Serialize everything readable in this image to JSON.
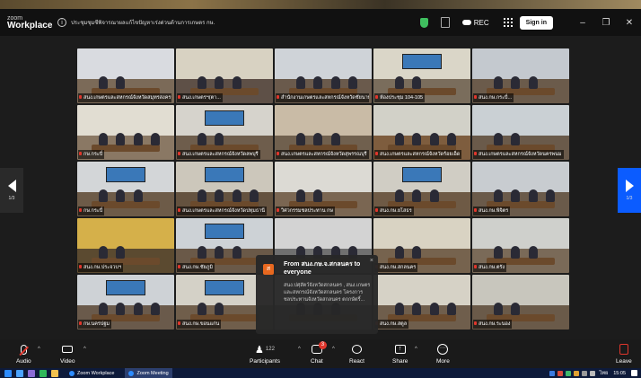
{
  "window": {
    "brand_top": "zoom",
    "brand_bottom": "Workplace",
    "meeting_title": "ประชุมชุมชีพิจารณาผลแก้ไขปัญหาเร่งด่วนด้านการเกษตร กษ.",
    "rec_label": "REC",
    "signin_label": "Sign in",
    "min_glyph": "–",
    "max_glyph": "❐",
    "close_glyph": "✕"
  },
  "tiles": [
    {
      "name": "สนง.เกษตรและสหกรณ์จังหวัดสมุทรสงคราม",
      "wall": "#d9dbe0",
      "floor": "#7b6a58",
      "screen": false,
      "active": false
    },
    {
      "name": "สนง.เกษตรฯ(ตา...",
      "wall": "#d8d2c2",
      "floor": "#5e5047",
      "screen": false,
      "active": false
    },
    {
      "name": "สำนักงานเกษตรและสหกรณ์จังหวัดชัยนาท",
      "wall": "#cfd3d8",
      "floor": "#6a5a4c",
      "screen": false,
      "active": false
    },
    {
      "name": "ห้องประชุม 104-105",
      "wall": "#dad6c8",
      "floor": "#7a6d5c",
      "screen": true,
      "active": true
    },
    {
      "name": "สนง.กษ.กระบี่...",
      "wall": "#c4c9cf",
      "floor": "#6b5b4b",
      "screen": false,
      "active": false
    },
    {
      "name": "กษ.กระบี่",
      "wall": "#e1ddd2",
      "floor": "#8a7864",
      "screen": false,
      "active": false
    },
    {
      "name": "สนง.เกษตรและสหกรณ์จังหวัดลพบุรี",
      "wall": "#d6d3cc",
      "floor": "#6e5d4c",
      "screen": true,
      "active": false
    },
    {
      "name": "สนง.เกษตรและสหกรณ์จังหวัดสุพรรณบุรี",
      "wall": "#c9bba6",
      "floor": "#70604e",
      "screen": false,
      "active": false
    },
    {
      "name": "สนง.เกษตรและสหกรณ์จังหวัดร้อยเอ็ด",
      "wall": "#d2d1c8",
      "floor": "#7e5d3e",
      "screen": false,
      "active": false
    },
    {
      "name": "สนง.เกษตรและสหกรณ์จังหวัดนครพนม",
      "wall": "#cad0d4",
      "floor": "#6a5a4a",
      "screen": false,
      "active": false
    },
    {
      "name": "กษ.กระบี่",
      "wall": "#d3d6d8",
      "floor": "#6d5b48",
      "screen": true,
      "active": false
    },
    {
      "name": "สนง.เกษตรและสหกรณ์จังหวัดปทุมธานี",
      "wall": "#ccc7bb",
      "floor": "#64523f",
      "screen": true,
      "active": false
    },
    {
      "name": "วิศวกรรมชลประทาน กษ",
      "wall": "#dcdad4",
      "floor": "#7a6652",
      "screen": false,
      "active": false
    },
    {
      "name": "สนง.กษ.ยโสธร",
      "wall": "#d0cdc4",
      "floor": "#6e5a45",
      "screen": true,
      "active": false
    },
    {
      "name": "สนง.กษ.พิจิตร",
      "wall": "#c8ccd0",
      "floor": "#6a5a4a",
      "screen": false,
      "active": false
    },
    {
      "name": "สนง.กษ.ประจวบฯ",
      "wall": "#d5b04a",
      "floor": "#5b4a30",
      "screen": false,
      "active": false
    },
    {
      "name": "สนง.กษ.ชัยภูมิ",
      "wall": "#cdd2d6",
      "floor": "#6a5948",
      "screen": true,
      "active": false
    },
    {
      "name": "",
      "wall": "#d3d3d3",
      "floor": "#707070",
      "screen": false,
      "active": false
    },
    {
      "name": "สนง.กษ.สกลนคร",
      "wall": "#d9d3c3",
      "floor": "#76634e",
      "screen": false,
      "active": false
    },
    {
      "name": "สนง.กษ.ตรัง",
      "wall": "#cfd0cc",
      "floor": "#7a6a58",
      "screen": false,
      "active": false
    },
    {
      "name": "กษ.นครปฐม",
      "wall": "#ced2d6",
      "floor": "#6a5a4b",
      "screen": true,
      "active": false
    },
    {
      "name": "สนง.กษ.ขอนแก่น",
      "wall": "#d4d1c7",
      "floor": "#705e4b",
      "screen": true,
      "active": false
    },
    {
      "name": "",
      "wall": "#d3d3d3",
      "floor": "#707070",
      "screen": false,
      "active": false
    },
    {
      "name": "สนง.กษ.สตูล",
      "wall": "#d6d2c6",
      "floor": "#6f5e4c",
      "screen": false,
      "active": false
    },
    {
      "name": "สนง.กษ.ระนอง",
      "wall": "#c8c6bd",
      "floor": "#6a5a49",
      "screen": false,
      "active": false
    }
  ],
  "chat": {
    "avatar_letter": "ส",
    "from": "From สนง.กษ.จ.สกลนคร to everyone",
    "message": "สนง.ปศุสัตว์จังหวัดสกลนคร , สนง.เกษตรและสหกรณ์จังหวัดสกลนคร โครงการชลประทานจังหวัดสกลนคร ตกกษัตริ์...",
    "close_glyph": "×"
  },
  "pager": {
    "left": "1/3",
    "right": "1/3"
  },
  "toolbar": {
    "audio": "Audio",
    "video": "Video",
    "participants": "Participants",
    "participants_count": "122",
    "chat": "Chat",
    "chat_badge": "3",
    "react": "React",
    "share": "Share",
    "more": "More",
    "leave": "Leave"
  },
  "taskbar": {
    "app1": "Zoom Workplace",
    "app2": "Zoom Meeting",
    "lang": "ไทย",
    "time": "15:05"
  },
  "colors": {
    "accent": "#0b5cff",
    "active_speaker": "#2ecc40",
    "alert": "#e0362c"
  }
}
